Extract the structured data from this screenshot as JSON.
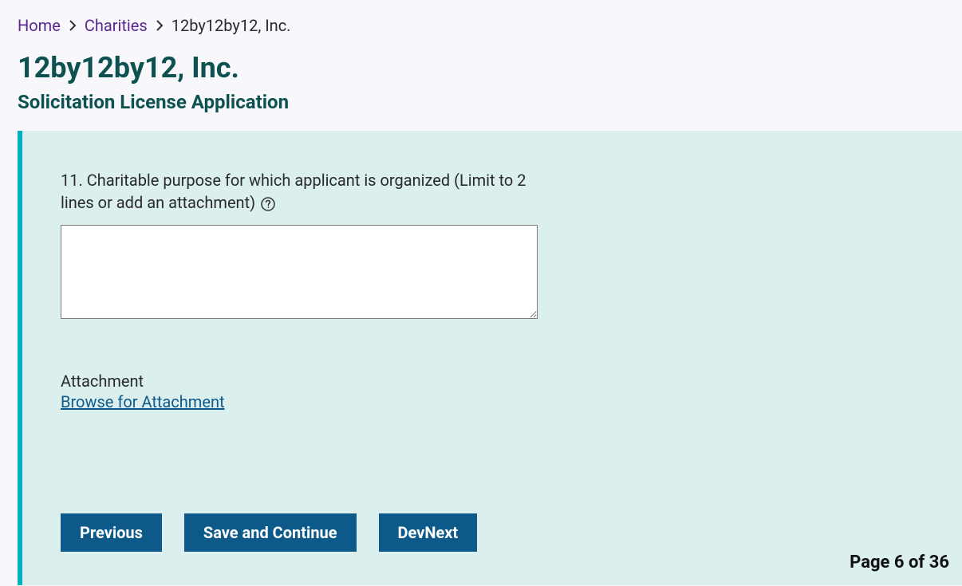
{
  "breadcrumb": {
    "home": "Home",
    "charities": "Charities",
    "current": "12by12by12, Inc."
  },
  "header": {
    "title": "12by12by12, Inc.",
    "subtitle": "Solicitation License Application"
  },
  "form": {
    "question_label": "11. Charitable purpose for which applicant is organized (Limit to 2 lines or add an attachment)",
    "textarea_value": "",
    "attachment_label": "Attachment",
    "browse_link": "Browse for Attachment"
  },
  "buttons": {
    "previous": "Previous",
    "save_continue": "Save and Continue",
    "devnext": "DevNext"
  },
  "pagination": {
    "text": "Page 6 of 36"
  }
}
